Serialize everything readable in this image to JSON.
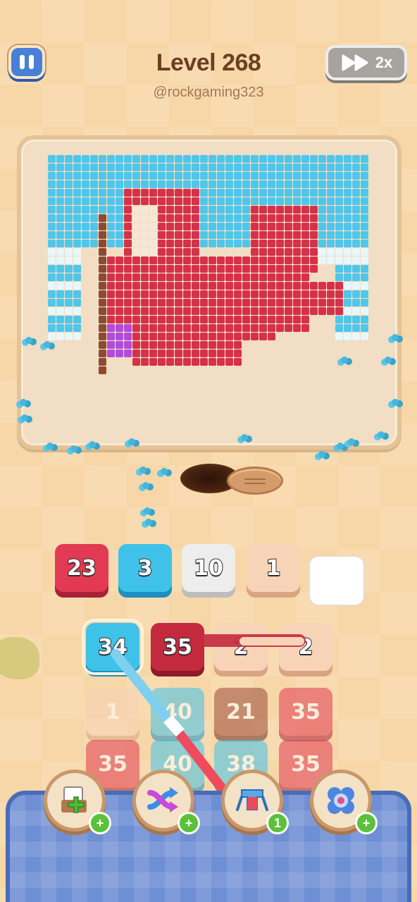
{
  "header": {
    "level_title": "Level 268",
    "username": "@rockgaming323",
    "speed_label": "2x"
  },
  "collector_slots": [
    {
      "value": "23",
      "color": "red"
    },
    {
      "value": "3",
      "color": "blue"
    },
    {
      "value": "10",
      "color": "white"
    },
    {
      "value": "1",
      "color": "peach"
    },
    {
      "value": "",
      "color": "empty"
    }
  ],
  "tile_grid": {
    "row1": [
      {
        "value": "34",
        "color": "blue"
      },
      {
        "value": "35",
        "color": "darkred"
      },
      {
        "value": "2",
        "color": "peach"
      },
      {
        "value": "2",
        "color": "peach"
      }
    ],
    "row2": [
      {
        "value": "1",
        "color": "peach"
      },
      {
        "value": "40",
        "color": "blue"
      },
      {
        "value": "21",
        "color": "brown"
      },
      {
        "value": "35",
        "color": "red"
      }
    ],
    "row3": [
      {
        "value": "35",
        "color": "red"
      },
      {
        "value": "40",
        "color": "blue"
      },
      {
        "value": "38",
        "color": "blue"
      },
      {
        "value": "35",
        "color": "red"
      }
    ]
  },
  "boosters": [
    {
      "icon": "add-slot-icon",
      "badge": "+"
    },
    {
      "icon": "shuffle-icon",
      "badge": "+"
    },
    {
      "icon": "magnet-icon",
      "badge": "1"
    },
    {
      "icon": "freeze-icon",
      "badge": "+"
    }
  ],
  "colors": {
    "pixel_blue": "#4fc6ea",
    "pixel_red": "#d6304a",
    "pixel_light": "#e8f7fb",
    "pixel_brown": "#8b4a32",
    "pixel_purple": "#b04bdc"
  }
}
